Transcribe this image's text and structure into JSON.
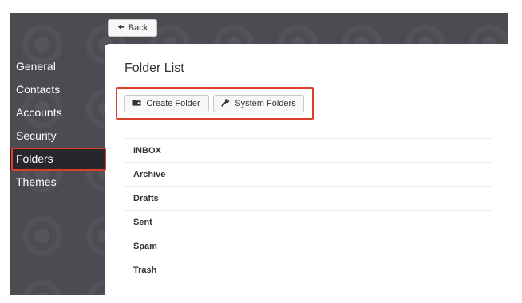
{
  "toolbar": {
    "back_label": "Back"
  },
  "sidebar": {
    "items": [
      {
        "label": "General",
        "active": false
      },
      {
        "label": "Contacts",
        "active": false
      },
      {
        "label": "Accounts",
        "active": false
      },
      {
        "label": "Security",
        "active": false
      },
      {
        "label": "Folders",
        "active": true
      },
      {
        "label": "Themes",
        "active": false
      }
    ]
  },
  "main": {
    "title": "Folder List",
    "buttons": {
      "create_folder": {
        "label": "Create Folder",
        "icon": "folder-plus-icon"
      },
      "system_folders": {
        "label": "System Folders",
        "icon": "wrench-icon"
      }
    },
    "folders": [
      "INBOX",
      "Archive",
      "Drafts",
      "Sent",
      "Spam",
      "Trash"
    ]
  },
  "colors": {
    "sidebar_bg": "#4a4c51",
    "active_item_bg": "#25272b",
    "highlight": "#d9402b"
  }
}
